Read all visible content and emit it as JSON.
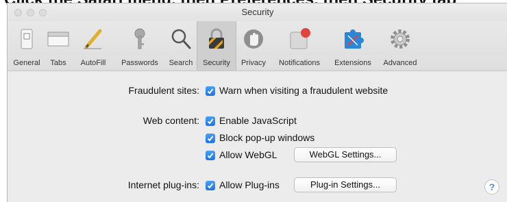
{
  "cropped_instruction": "Click the Safari menu, then Preferences, then Security tab",
  "window": {
    "title": "Security"
  },
  "toolbar": {
    "items": [
      {
        "label": "General",
        "icon": "general-switch-icon"
      },
      {
        "label": "Tabs",
        "icon": "tabs-icon"
      },
      {
        "label": "AutoFill",
        "icon": "pencil-icon"
      },
      {
        "label": "Passwords",
        "icon": "key-icon"
      },
      {
        "label": "Search",
        "icon": "search-icon"
      },
      {
        "label": "Security",
        "icon": "padlock-icon"
      },
      {
        "label": "Privacy",
        "icon": "hand-icon"
      },
      {
        "label": "Notifications",
        "icon": "notification-badge-icon"
      },
      {
        "label": "Extensions",
        "icon": "puzzle-icon"
      },
      {
        "label": "Advanced",
        "icon": "gear-icon"
      }
    ],
    "selected": "Security"
  },
  "settings": {
    "fraudulent_label": "Fraudulent sites:",
    "fraudulent_option": "Warn when visiting a fraudulent website",
    "web_content_label": "Web content:",
    "enable_js": "Enable JavaScript",
    "block_popups": "Block pop-up windows",
    "allow_webgl": "Allow WebGL",
    "webgl_settings_button": "WebGL Settings...",
    "plugins_label": "Internet plug-ins:",
    "allow_plugins": "Allow Plug-ins",
    "plugin_settings_button": "Plug-in Settings...",
    "help": "?"
  },
  "colors": {
    "checkbox_blue": "#1b73e8",
    "accent": "#4a90e2",
    "badge_red": "#e0443e"
  }
}
